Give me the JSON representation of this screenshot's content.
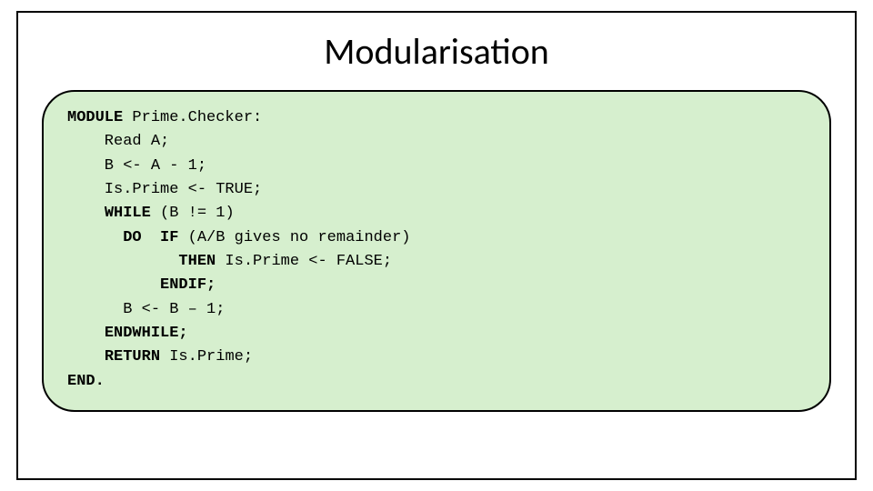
{
  "slide": {
    "title": "Modularisation"
  },
  "code": {
    "l1a": "MODULE",
    "l1b": " Prime.Checker:",
    "l2": "    Read A;",
    "l3": "    B <- A - 1;",
    "l4": "    Is.Prime <- TRUE;",
    "l5a": "    ",
    "l5b": "WHILE",
    "l5c": " (B != 1)",
    "l6a": "      ",
    "l6b": "DO",
    "l6c": "  ",
    "l6d": "IF",
    "l6e": " (A/B gives no remainder)",
    "l7a": "            ",
    "l7b": "THEN",
    "l7c": " Is.Prime <- FALSE;",
    "l8a": "          ",
    "l8b": "ENDIF;",
    "l9": "      B <- B – 1;",
    "l10a": "    ",
    "l10b": "ENDWHILE;",
    "l11a": "    ",
    "l11b": "RETURN",
    "l11c": " Is.Prime;",
    "l12": "END."
  }
}
